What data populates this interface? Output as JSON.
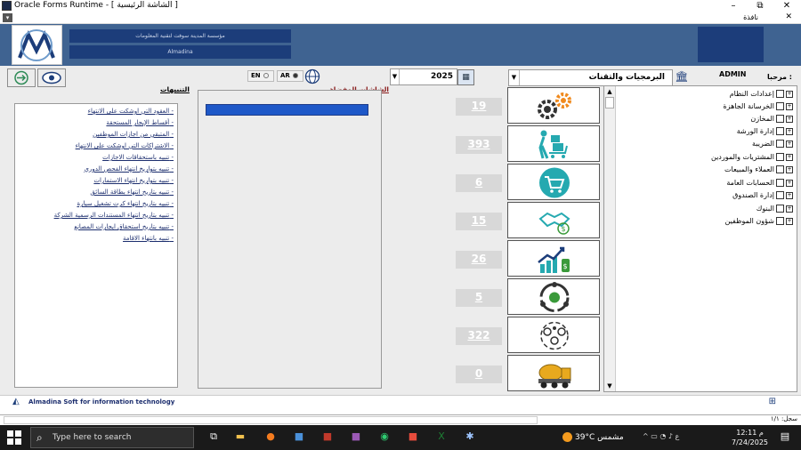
{
  "window": {
    "title": "Oracle Forms Runtime - [ الشاشة الرئيسية ]",
    "window_menu": "نافذة",
    "minimize": "–",
    "maximize": "⧉",
    "close": "✕",
    "menu_close": "✕"
  },
  "header": {
    "org_name_ar": "مؤسسة المدينة سوفت لتقنية المعلومات",
    "org_name_en": "Almadina"
  },
  "toolbar": {
    "lang_en": "EN",
    "lang_ar": "AR",
    "lang_selected": "AR",
    "year": "2025",
    "module": "البرمجيات والتقنات",
    "greeting_label": "مرحبا :",
    "username": "ADMIN"
  },
  "notifications": {
    "heading": "التنبيهات",
    "items": [
      "العقود التي اوشكت على الانتهاء -",
      "أقساط الإيجار المستحقة -",
      "المتبقي من اجازات الموظفين -",
      "الاشتراكات التي اوشكت على الانتهاء -",
      "تنبيه باستحقاقات الاجازات -",
      "تنبيه بتواريخ انتهاء الفحص الدوري -",
      "تنبيه بتواريخ انتهاء الاستمارات -",
      "تنبيه بتاريخ انتهاء بطاقة السائق -",
      "تنبيه بتاريخ انتهاء كرت تشغيل سيارة -",
      "تنبيه بتاريخ انتهاء المستندات الرسمية الشركة -",
      "تنبيه بتاريخ استحقاق ايجارات المصانع -",
      "تنبيه بانتهاء الاقامة -"
    ]
  },
  "favorites": {
    "heading": "الشاشات المفضلة"
  },
  "modules": [
    {
      "count": "19",
      "icon": "gears-icon"
    },
    {
      "count": "393",
      "icon": "warehouse-worker-icon"
    },
    {
      "count": "6",
      "icon": "shopping-cart-icon"
    },
    {
      "count": "15",
      "icon": "handshake-money-icon"
    },
    {
      "count": "26",
      "icon": "growth-chart-icon"
    },
    {
      "count": "5",
      "icon": "cycle-icon"
    },
    {
      "count": "322",
      "icon": "people-gears-icon"
    },
    {
      "count": "0",
      "icon": "concrete-mixer-icon"
    }
  ],
  "tree": {
    "items": [
      "إعدادات النظام",
      "الخرسانة الجاهزة",
      "المخازن",
      "إدارة الورشة",
      "الضريبة",
      "المشتريات والموردين",
      "العملاء والمبيعات",
      "الحسابات العامة",
      "إدارة الصندوق",
      "البنوك",
      "شؤون الموظفين"
    ]
  },
  "footer": {
    "company": "Almadina Soft for information technology",
    "record": "سجل: ١/١"
  },
  "taskbar": {
    "search_placeholder": "Type here to search",
    "weather": "39°C  مشمس",
    "time": "12:11 م",
    "date": "7/24/2025",
    "lang": "ع"
  },
  "colors": {
    "header_bg": "#3f6391",
    "header_box": "#1c3d7a",
    "main_bg": "#ececec",
    "accent_teal": "#25a9b0",
    "selection_blue": "#1e58c8"
  }
}
